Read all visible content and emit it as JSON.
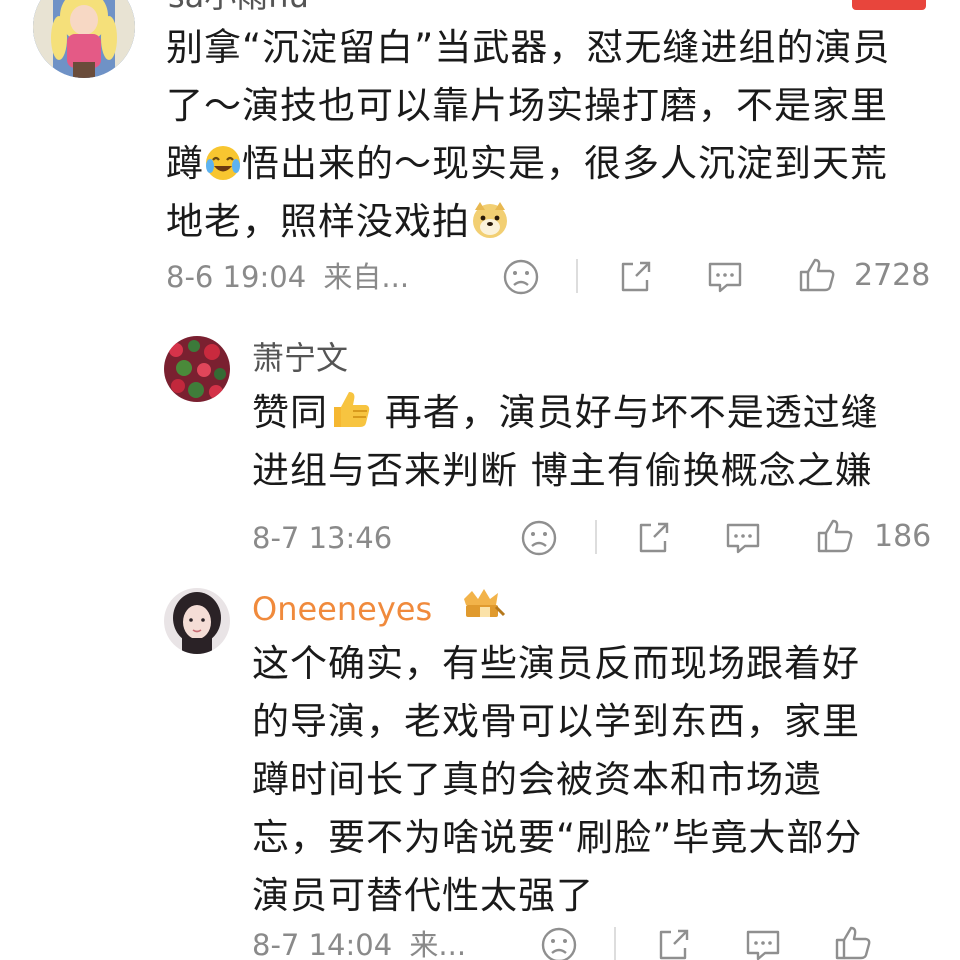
{
  "comments": [
    {
      "username": "sa小雨hu",
      "lines": [
        "别拿“沉淀留白”当武器，怼无缝进组的演员",
        "了～演技也可以靠片场实操打磨，不是家里",
        "蹲",
        "悟出来的～现实是，很多人沉淀到天荒",
        "地老，照样没戏拍"
      ],
      "time": "8-6 19:04",
      "source": "来自...",
      "likes": "2728"
    },
    {
      "username": "萧宁文",
      "lines": [
        "赞同",
        " 再者，演员好与坏不是透过缝",
        "进组与否来判断 博主有偷换概念之嫌"
      ],
      "time": "8-7 13:46",
      "likes": "186"
    },
    {
      "username": "Oneeneyes",
      "lines": [
        "这个确实，有些演员反而现场跟着好",
        "的导演，老戏骨可以学到东西，家里",
        "蹲时间长了真的会被资本和市场遗",
        "忘，要不为啥说要“刷脸”毕竟大部分",
        "演员可替代性太强了"
      ],
      "time": "8-7 14:04",
      "source": "来..."
    }
  ],
  "icons": {
    "emoji_1": "crying-laughing-emoji",
    "emoji_2": "doge-emoji",
    "emoji_3": "thumbs-up-emoji",
    "badge": "crown-badge-icon"
  },
  "colors": {
    "text": "#1a1a1a",
    "meta": "#8a8a8a",
    "username_gray": "#555555",
    "username_orange": "#f08a3c"
  }
}
